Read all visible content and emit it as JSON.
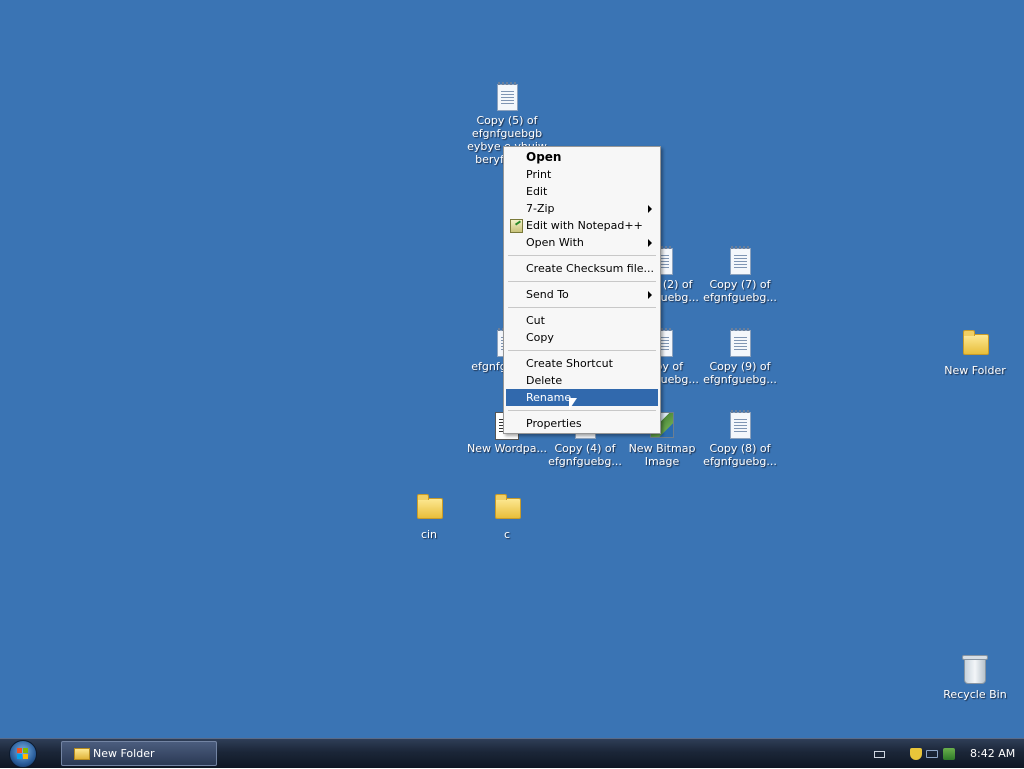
{
  "desktop": {
    "background": "#3a74b4",
    "icons": [
      {
        "id": "copy5",
        "label": "Copy (5) of efgnfguebgb eybye e yhuiw beryfb yreb",
        "type": "document"
      },
      {
        "id": "copy2",
        "label": "Copy (2) of efgnfguebg...",
        "type": "document"
      },
      {
        "id": "copy7",
        "label": "Copy (7) of efgnfguebg...",
        "type": "document"
      },
      {
        "id": "efgnf",
        "label": "efgnfg yhuiw",
        "type": "document"
      },
      {
        "id": "copy3",
        "label": "Copy of efgnfguebg...",
        "type": "document"
      },
      {
        "id": "copy9",
        "label": "Copy (9) of efgnfguebg...",
        "type": "document"
      },
      {
        "id": "newfolder",
        "label": "New Folder",
        "type": "folder"
      },
      {
        "id": "wordpad",
        "label": "New Wordpa...",
        "type": "wordpad"
      },
      {
        "id": "copy4",
        "label": "Copy (4) of efgnfguebg...",
        "type": "document"
      },
      {
        "id": "bitmap",
        "label": "New Bitmap Image",
        "type": "bitmap"
      },
      {
        "id": "copy8",
        "label": "Copy (8) of efgnfguebg...",
        "type": "document"
      },
      {
        "id": "cin",
        "label": "cin",
        "type": "folder"
      },
      {
        "id": "c",
        "label": "c",
        "type": "folder"
      },
      {
        "id": "recycle",
        "label": "Recycle Bin",
        "type": "recycle-bin"
      }
    ]
  },
  "context_menu": {
    "items": {
      "open": "Open",
      "print": "Print",
      "edit": "Edit",
      "sevenzip": "7-Zip",
      "notepadpp": "Edit with Notepad++",
      "open_with": "Open With",
      "checksum": "Create Checksum file...",
      "send_to": "Send To",
      "cut": "Cut",
      "copy": "Copy",
      "create_shortcut": "Create Shortcut",
      "delete": "Delete",
      "rename": "Rename",
      "properties": "Properties"
    },
    "selected": "Rename",
    "highlight_color": "#3169ad"
  },
  "taskbar": {
    "start_icon": "windows-orb-icon",
    "window_button": "New Folder",
    "tray_icons": [
      "keyboard-icon",
      "shield-icon",
      "network-icon",
      "power-icon"
    ],
    "clock": "8:42 AM"
  }
}
